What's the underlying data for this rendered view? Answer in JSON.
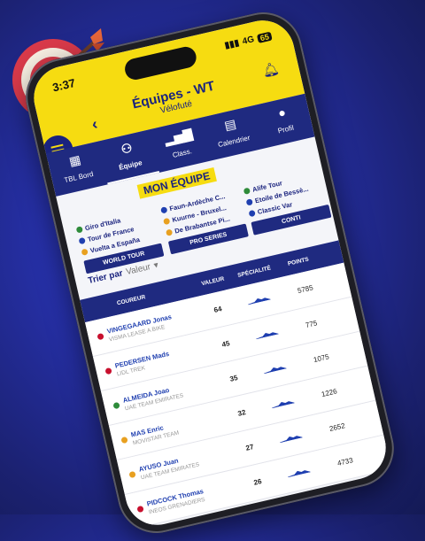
{
  "status": {
    "time": "3:37",
    "network": "4G",
    "battery": "65"
  },
  "header": {
    "title": "Équipes - WT",
    "subtitle": "Vélofuté"
  },
  "nav": [
    {
      "label": "TBL Bord",
      "icon": "dashboard-icon"
    },
    {
      "label": "Équipe",
      "icon": "team-icon"
    },
    {
      "label": "Class.",
      "icon": "ranking-icon"
    },
    {
      "label": "Calendrier",
      "icon": "calendar-icon"
    },
    {
      "label": "Profil",
      "icon": "profile-icon"
    }
  ],
  "section_title": "MON ÉQUIPE",
  "races": {
    "world_tour": [
      "Giro d'Italia",
      "Tour de France",
      "Vuelta a España"
    ],
    "pro_series": [
      "Faun-Ardèche C...",
      "Kuurne - Bruxel...",
      "De Brabantse Pi..."
    ],
    "conti": [
      "Alife Tour",
      "Etoile de Bessè...",
      "Classic Var"
    ]
  },
  "buttons": {
    "world_tour": "WORLD TOUR",
    "pro_series": "PRO SERIES",
    "conti": "CONTI"
  },
  "sort": {
    "label": "Trier par",
    "value": "Valeur"
  },
  "table": {
    "headers": {
      "coureur": "COUREUR",
      "valeur": "VALEUR",
      "specialite": "SPÉCIALITÉ",
      "points": "POINTS"
    },
    "rows": [
      {
        "name": "VINGEGAARD Jonas",
        "team": "VISMA LEASE A BIKE",
        "value": "64",
        "points": "5785",
        "flag": "#c8102e"
      },
      {
        "name": "PEDERSEN Mads",
        "team": "LIDL TREK",
        "value": "45",
        "points": "775",
        "flag": "#c8102e"
      },
      {
        "name": "ALMEIDA Joao",
        "team": "UAE TEAM EMIRATES",
        "value": "35",
        "points": "1075",
        "flag": "#2e8b3a"
      },
      {
        "name": "MAS Enric",
        "team": "MOVISTAR TEAM",
        "value": "32",
        "points": "1226",
        "flag": "#e8a020"
      },
      {
        "name": "AYUSO Juan",
        "team": "UAE TEAM EMIRATES",
        "value": "27",
        "points": "2652",
        "flag": "#e8a020"
      },
      {
        "name": "PIDCOCK Thomas",
        "team": "INEOS GRENADIERS",
        "value": "26",
        "points": "4733",
        "flag": "#c8102e"
      }
    ]
  },
  "colors": {
    "accent_yellow": "#f6dc11",
    "navy": "#1f2a80"
  }
}
